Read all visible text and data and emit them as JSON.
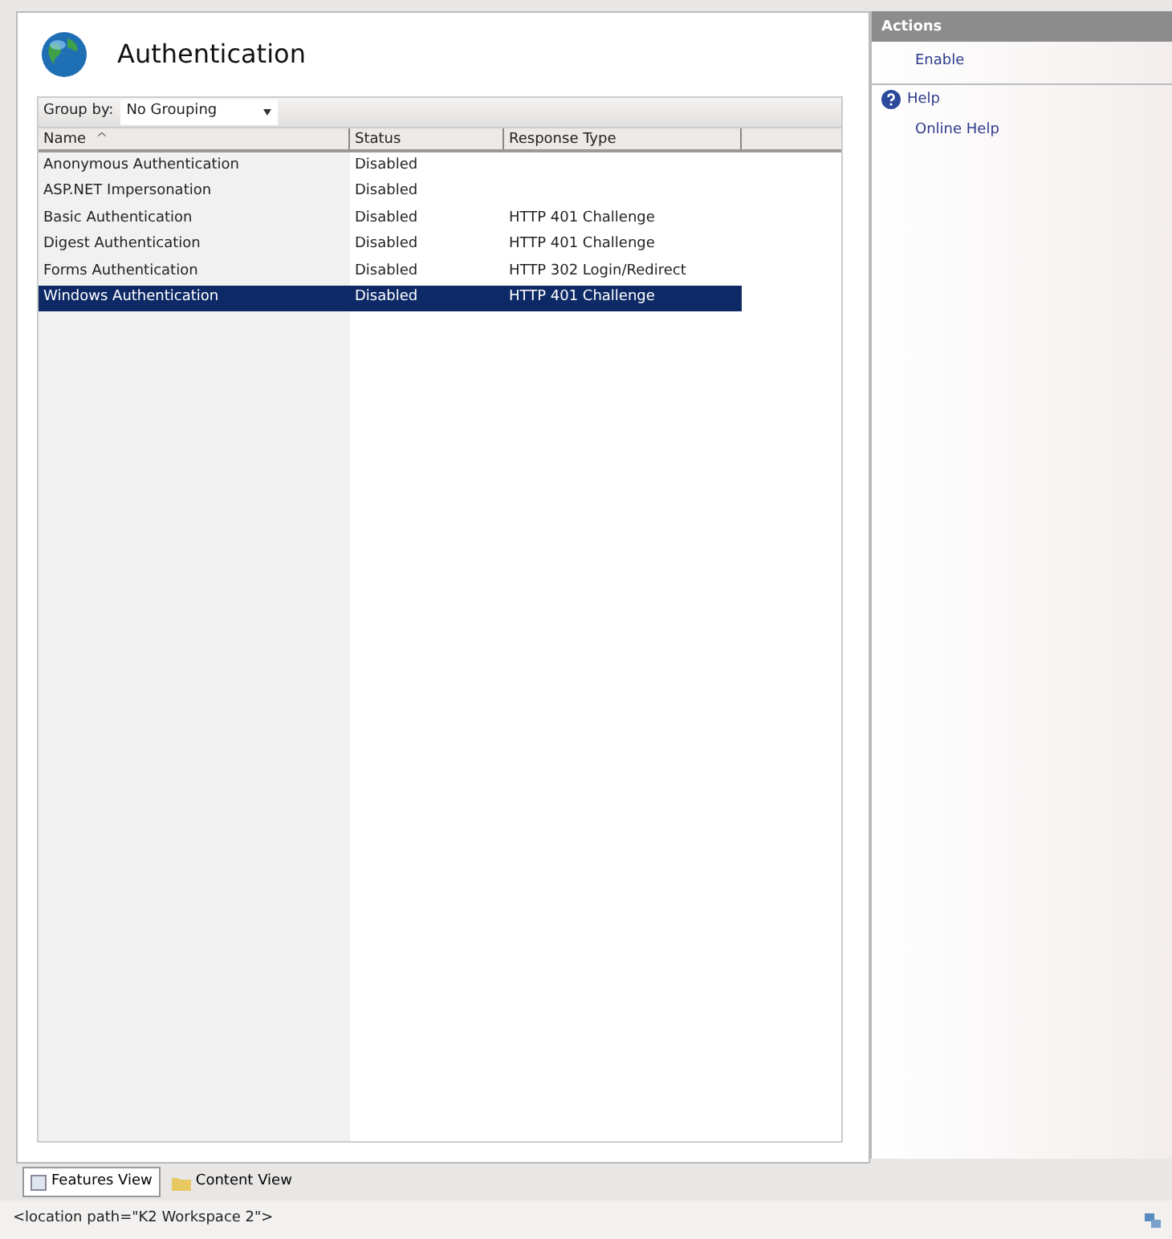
{
  "title": "Authentication",
  "group_by": {
    "label": "Group by:",
    "value": "No Grouping"
  },
  "columns": [
    {
      "label": "Name",
      "sort_mark": "^"
    },
    {
      "label": "Status"
    },
    {
      "label": "Response Type"
    }
  ],
  "rows": [
    {
      "name": "Anonymous Authentication",
      "status": "Disabled",
      "response_type": "",
      "selected": false
    },
    {
      "name": "ASP.NET Impersonation",
      "status": "Disabled",
      "response_type": "",
      "selected": false
    },
    {
      "name": "Basic Authentication",
      "status": "Disabled",
      "response_type": "HTTP 401 Challenge",
      "selected": false
    },
    {
      "name": "Digest Authentication",
      "status": "Disabled",
      "response_type": "HTTP 401 Challenge",
      "selected": false
    },
    {
      "name": "Forms Authentication",
      "status": "Disabled",
      "response_type": "HTTP 302 Login/Redirect",
      "selected": false
    },
    {
      "name": "Windows Authentication",
      "status": "Disabled",
      "response_type": "HTTP 401 Challenge",
      "selected": true
    }
  ],
  "view_tabs": [
    {
      "label": "Features View",
      "selected": true
    },
    {
      "label": "Content View",
      "selected": false
    }
  ],
  "actions": {
    "title": "Actions",
    "items": [
      {
        "label": "Enable",
        "kind": "link"
      },
      {
        "label": "Help",
        "kind": "help"
      },
      {
        "label": "Online Help",
        "kind": "link"
      }
    ]
  },
  "status_bar": "<location path=\"K2 Workspace 2\">"
}
